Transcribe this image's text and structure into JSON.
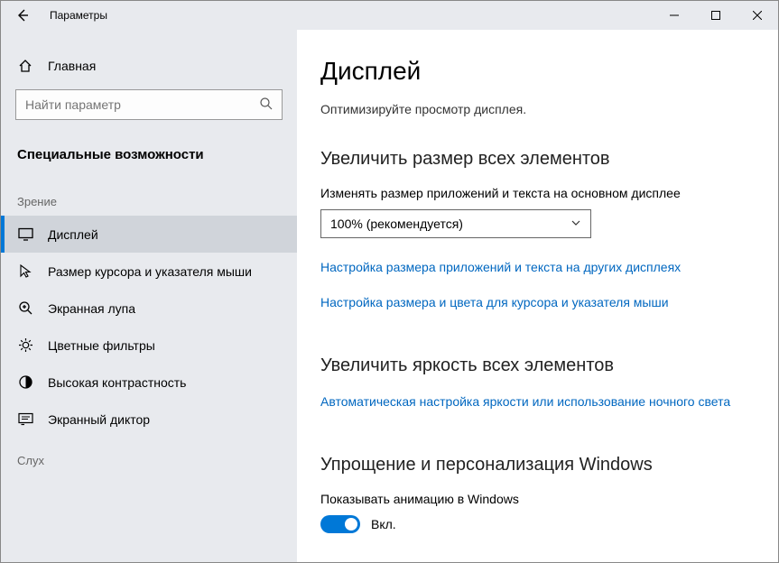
{
  "window": {
    "title": "Параметры"
  },
  "sidebar": {
    "home_label": "Главная",
    "search_placeholder": "Найти параметр",
    "category": "Специальные возможности",
    "group_vision": "Зрение",
    "group_hearing": "Слух",
    "items": [
      {
        "label": "Дисплей"
      },
      {
        "label": "Размер курсора и указателя мыши"
      },
      {
        "label": "Экранная лупа"
      },
      {
        "label": "Цветные фильтры"
      },
      {
        "label": "Высокая контрастность"
      },
      {
        "label": "Экранный диктор"
      }
    ]
  },
  "main": {
    "title": "Дисплей",
    "subtitle": "Оптимизируйте просмотр дисплея.",
    "scale": {
      "heading": "Увеличить размер всех элементов",
      "label": "Изменять размер приложений и текста на основном дисплее",
      "dropdown_value": "100% (рекомендуется)",
      "link_other_displays": "Настройка размера приложений и текста на других дисплеях",
      "link_cursor": "Настройка размера и цвета для курсора и указателя мыши"
    },
    "brightness": {
      "heading": "Увеличить яркость всех элементов",
      "link_auto": "Автоматическая настройка яркости или использование ночного света"
    },
    "simplify": {
      "heading": "Упрощение и персонализация Windows",
      "animations_label": "Показывать анимацию в Windows",
      "toggle_label": "Вкл."
    }
  }
}
